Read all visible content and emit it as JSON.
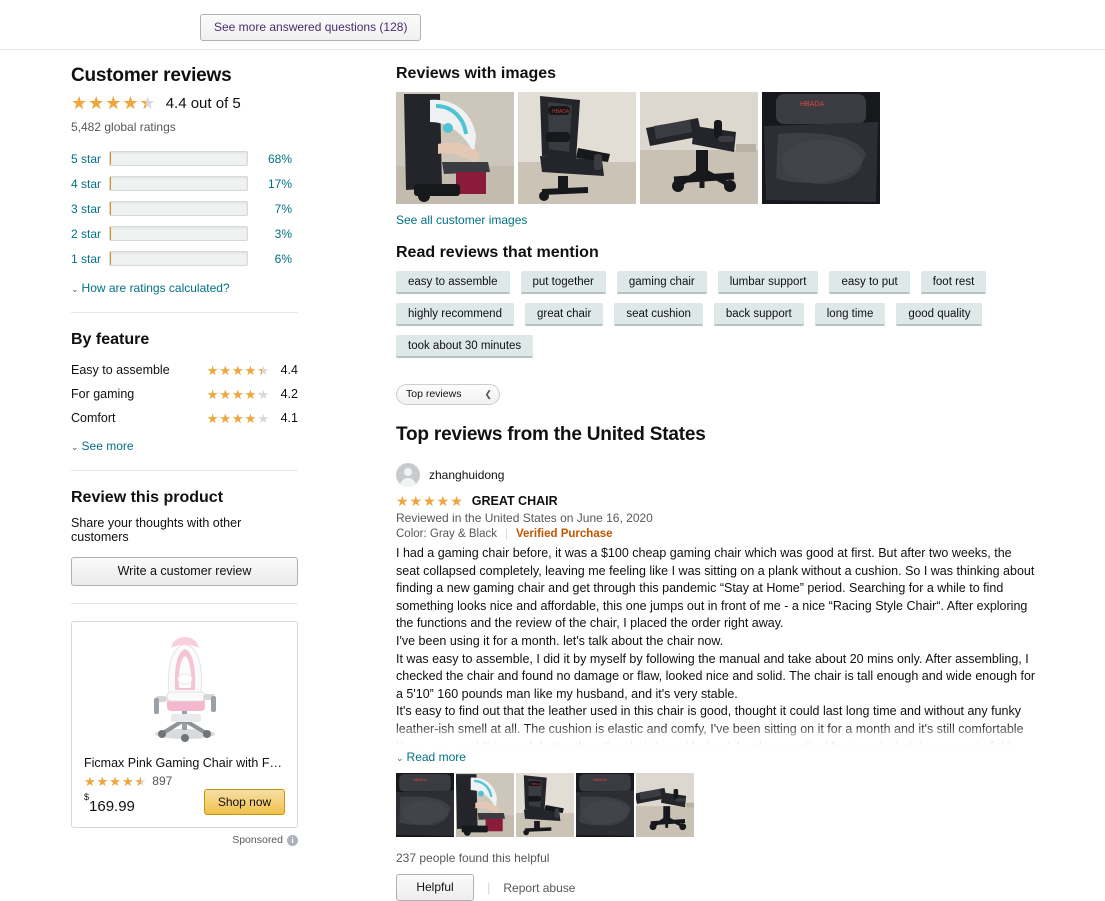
{
  "top": {
    "see_more_questions_label": "See more answered questions (128)"
  },
  "customer_reviews": {
    "heading": "Customer reviews",
    "rating_value": 4.4,
    "rating_text": "4.4 out of 5",
    "global_ratings": "5,482 global ratings",
    "histogram": [
      {
        "label": "5 star",
        "percent": "68%",
        "value": 68
      },
      {
        "label": "4 star",
        "percent": "17%",
        "value": 17
      },
      {
        "label": "3 star",
        "percent": "7%",
        "value": 7
      },
      {
        "label": "2 star",
        "percent": "3%",
        "value": 3
      },
      {
        "label": "1 star",
        "percent": "6%",
        "value": 6
      }
    ],
    "how_calculated_label": "How are ratings calculated?"
  },
  "by_feature": {
    "heading": "By feature",
    "features": [
      {
        "name": "Easy to assemble",
        "score": "4.4",
        "value": 4.4
      },
      {
        "name": "For gaming",
        "score": "4.2",
        "value": 4.2
      },
      {
        "name": "Comfort",
        "score": "4.1",
        "value": 4.1
      }
    ],
    "see_more_label": "See more"
  },
  "review_this_product": {
    "heading": "Review this product",
    "subtitle": "Share your thoughts with other customers",
    "write_review_label": "Write a customer review"
  },
  "sponsored_ad": {
    "title": "Ficmax Pink Gaming Chair with Footrest, ...",
    "rating_value": 4.5,
    "review_count": "897",
    "price_symbol": "$",
    "price": "169.99",
    "shop_now_label": "Shop now",
    "sponsored_label": "Sponsored",
    "info_icon_glyph": "i"
  },
  "reviews_with_images": {
    "heading": "Reviews with images",
    "see_all_label": "See all customer images",
    "photo_count": 4
  },
  "mentions": {
    "heading": "Read reviews that mention",
    "chips": [
      "easy to assemble",
      "put together",
      "gaming chair",
      "lumbar support",
      "easy to put",
      "foot rest",
      "highly recommend",
      "great chair",
      "seat cushion",
      "back support",
      "long time",
      "good quality",
      "took about 30 minutes"
    ]
  },
  "sort": {
    "selected": "Top reviews",
    "chevron_glyph": "⌄"
  },
  "reviews_section": {
    "heading": "Top reviews from the United States",
    "review": {
      "reviewer_name": "zhanghuidong",
      "rating_value": 5,
      "title": "GREAT CHAIR",
      "date": "Reviewed in the United States on June 16, 2020",
      "color": "Color: Gray & Black",
      "verified_purchase": "Verified Purchase",
      "paragraphs": [
        "I had a gaming chair before, it was a $100 cheap gaming chair which was good at first. But after two weeks, the seat collapsed completely, leaving me feeling like I was sitting on a plank without a cushion. So I was thinking about finding a new gaming chair and get through this pandemic “Stay at Home” period. Searching for a while to find something looks nice and affordable, this one jumps out in front of me - a nice “Racing Style Chair“. After exploring the functions and the review of the chair, I placed the order right away.",
        "I've been using it for a month. let's talk about the chair now.",
        "It was easy to assemble, I did it by myself by following the manual and take about 20 mins only. After assembling, I checked the chair and found no damage or flaw, looked nice and solid. The chair is tall enough and wide enough for a 5'10” 160 pounds man like my husband, and it's very stable.",
        "It's easy to find out that the leather used in this chair is good, thought it could last long time and without any funky leather-ish smell at all. The cushion is elastic and comfy, I've been sitting on it for a month and it's still comfortable like a new one! It is much better than the chair I used before! Another practical features is that the armrest of this chair is designed adjustable , can support my arms and relax my"
      ],
      "read_more_label": "Read more",
      "thumbnail_count": 5,
      "helpful_count": "237 people found this helpful",
      "helpful_label": "Helpful",
      "report_abuse_label": "Report abuse"
    }
  },
  "colors": {
    "star": "#f0a63a",
    "bar_fill": "#f8a028",
    "link": "#007185",
    "verified": "#c45500",
    "chip_bg": "#dfe8e9"
  }
}
